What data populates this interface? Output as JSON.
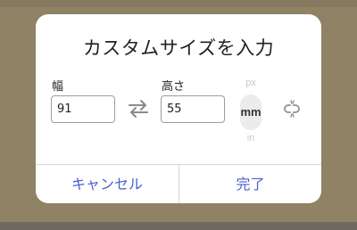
{
  "dialog": {
    "title": "カスタムサイズを入力",
    "width_label": "幅",
    "width_value": "91",
    "height_label": "高さ",
    "height_value": "55",
    "units": [
      "px",
      "mm",
      "in"
    ],
    "selected_unit": "mm",
    "cancel_label": "キャンセル",
    "done_label": "完了"
  },
  "colors": {
    "accent": "#4a5fd0",
    "backdrop": "#8f8265"
  },
  "icons": {
    "swap": "swap-arrows-icon",
    "link": "unlink-icon"
  }
}
